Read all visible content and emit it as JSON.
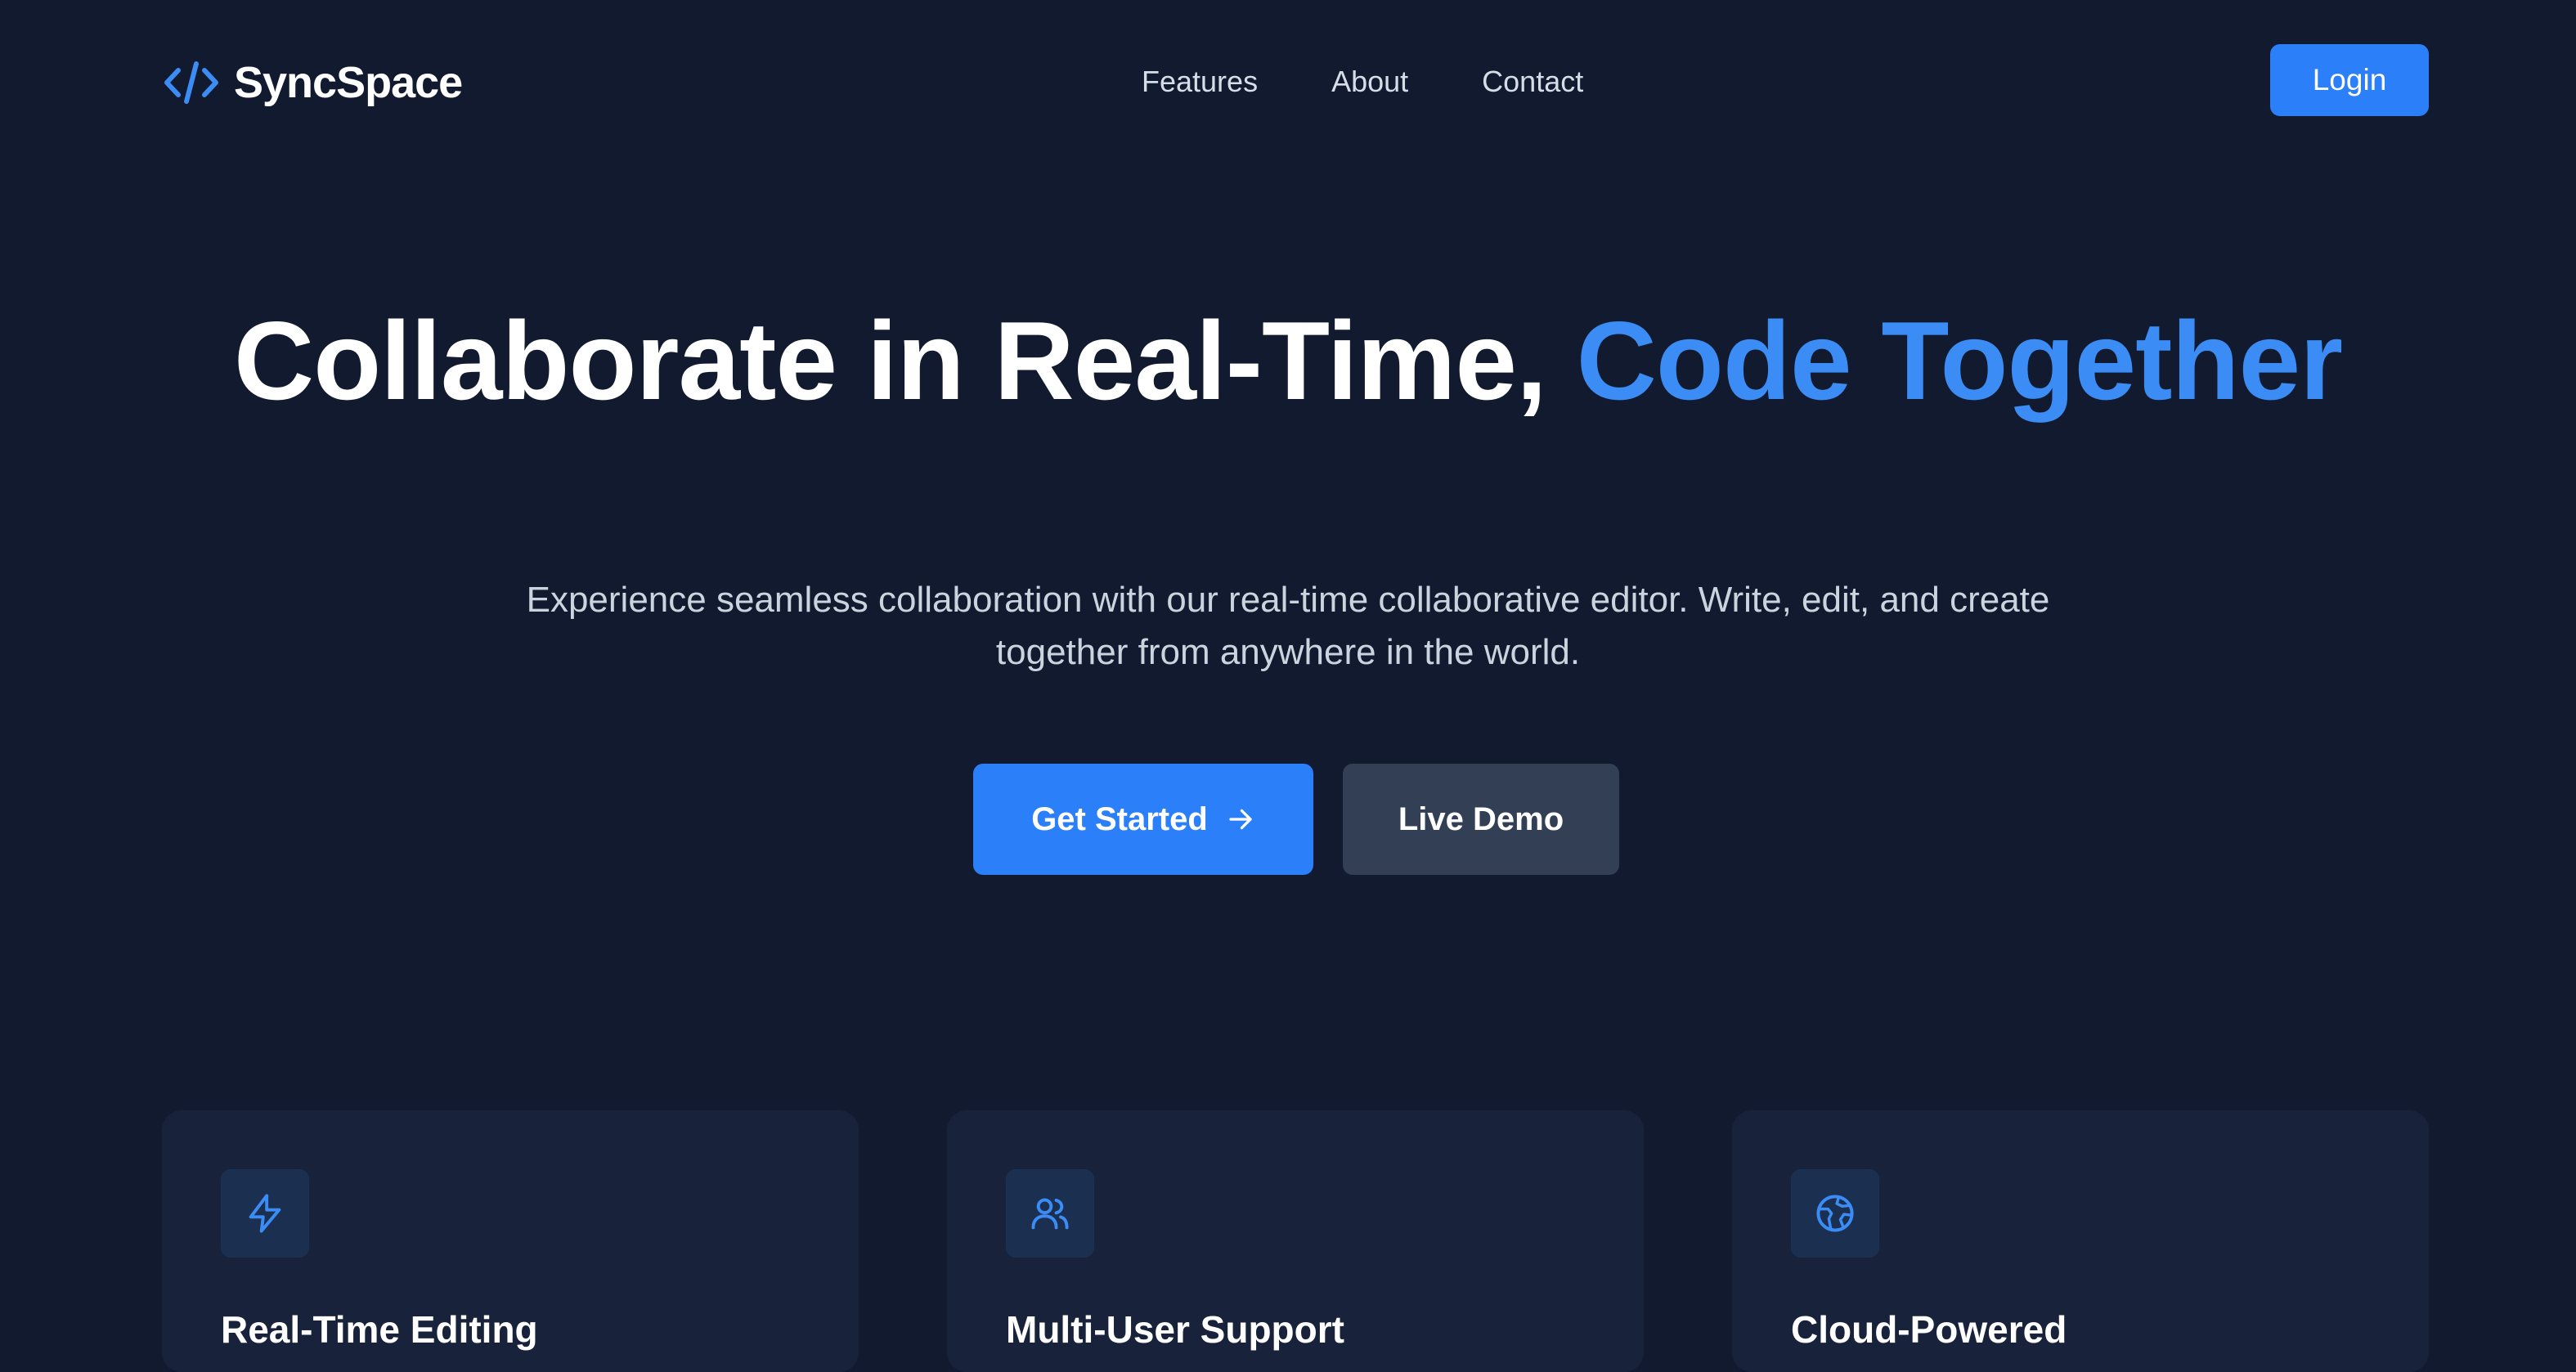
{
  "brand": {
    "name": "SyncSpace",
    "icon": "code-brackets-icon",
    "accent_color": "#3b8cf5"
  },
  "nav": {
    "links": [
      "Features",
      "About",
      "Contact"
    ],
    "login_label": "Login"
  },
  "hero": {
    "title_main": "Collaborate in Real-Time,",
    "title_accent": "Code Together",
    "subtitle": "Experience seamless collaboration with our real-time collaborative editor. Write, edit, and create together from anywhere in the world.",
    "primary_button": "Get Started",
    "primary_button_icon": "arrow-right-icon",
    "secondary_button": "Live Demo"
  },
  "features": [
    {
      "title": "Real-Time Editing",
      "icon": "lightning-icon"
    },
    {
      "title": "Multi-User Support",
      "icon": "users-icon"
    },
    {
      "title": "Cloud-Powered",
      "icon": "globe-icon"
    }
  ],
  "colors": {
    "background": "#111a2e",
    "primary": "#2b7ff8",
    "secondary_button": "#323f55",
    "card": "#18223a"
  }
}
